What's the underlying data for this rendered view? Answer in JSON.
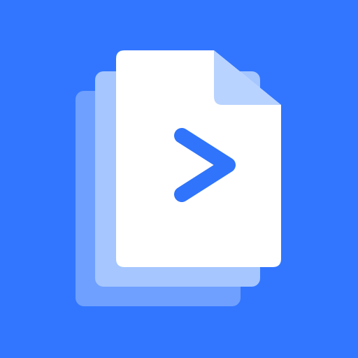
{
  "icon": {
    "name": "document-stack-chevron-icon",
    "background_color": "#3276FF",
    "back_page_color": "#6FA0FF",
    "middle_page_color": "#A5C6FF",
    "front_page_color": "#FFFFFF",
    "fold_color": "#B8D3FF",
    "chevron_color": "#2F74FB"
  }
}
